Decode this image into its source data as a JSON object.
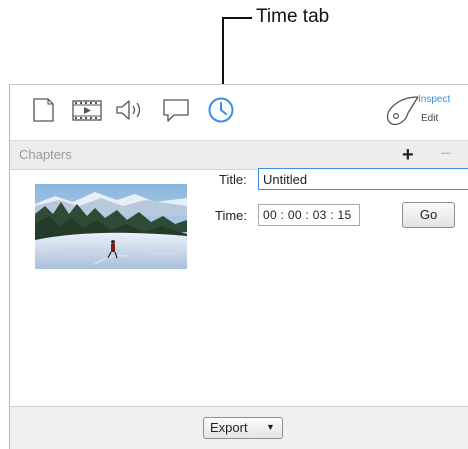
{
  "callout": {
    "label": "Time tab"
  },
  "toolbar": {
    "icons": [
      "document-icon",
      "film-icon",
      "speaker-icon",
      "speech-bubble-icon",
      "clock-icon"
    ],
    "inspect_label": "Inspect",
    "edit_label": "Edit",
    "active_color": "#3a8ee6"
  },
  "chapters": {
    "header": "Chapters",
    "add_label": "+",
    "remove_label": "−"
  },
  "form": {
    "title_label": "Title:",
    "title_value": "Untitled",
    "time_label": "Time:",
    "time_value": "00 : 00 : 03 : 15",
    "go_label": "Go"
  },
  "footer": {
    "export_label": "Export",
    "export_caret": "▼"
  }
}
